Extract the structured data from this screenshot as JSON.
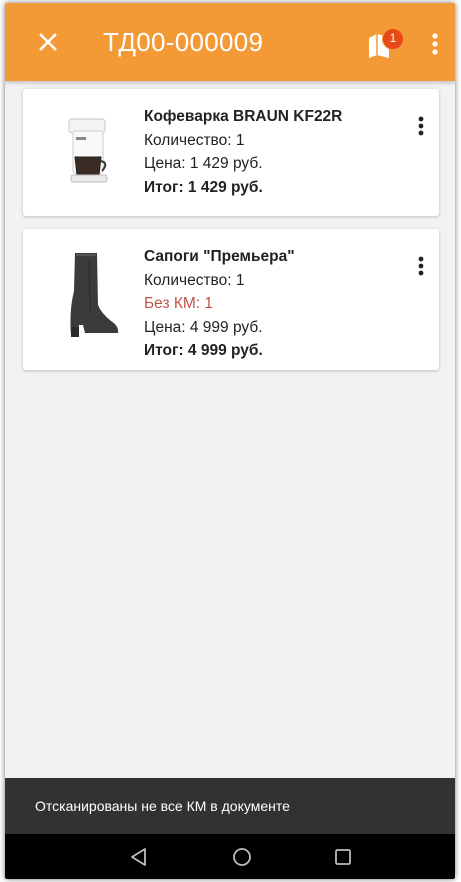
{
  "appbar": {
    "title": "ТД00-000009",
    "badge_count": "1",
    "close_icon": "close-icon",
    "doc_icon": "document-icon",
    "more_icon": "more-vertical-icon",
    "color": "#f39a37"
  },
  "items": [
    {
      "name": "Кофеварка BRAUN KF22R",
      "quantity": "Количество: 1",
      "price": "Цена: 1 429 руб.",
      "total": "Итог: 1 429 руб.",
      "thumbnail": "coffee-maker-image"
    },
    {
      "name": "Сапоги \"Премьера\"",
      "quantity": "Количество: 1",
      "km_warning": "Без КМ: 1",
      "price": "Цена: 4 999 руб.",
      "total": "Итог: 4 999 руб.",
      "thumbnail": "boot-image"
    }
  ],
  "snackbar": {
    "message": "Отсканированы не все КМ в документе"
  },
  "navbar": {
    "back": "back-triangle-icon",
    "home": "home-circle-icon",
    "recents": "recents-square-icon"
  },
  "colors": {
    "warning_text": "#c0544a",
    "snackbar_bg": "#323232",
    "badge": "#e64a19"
  }
}
